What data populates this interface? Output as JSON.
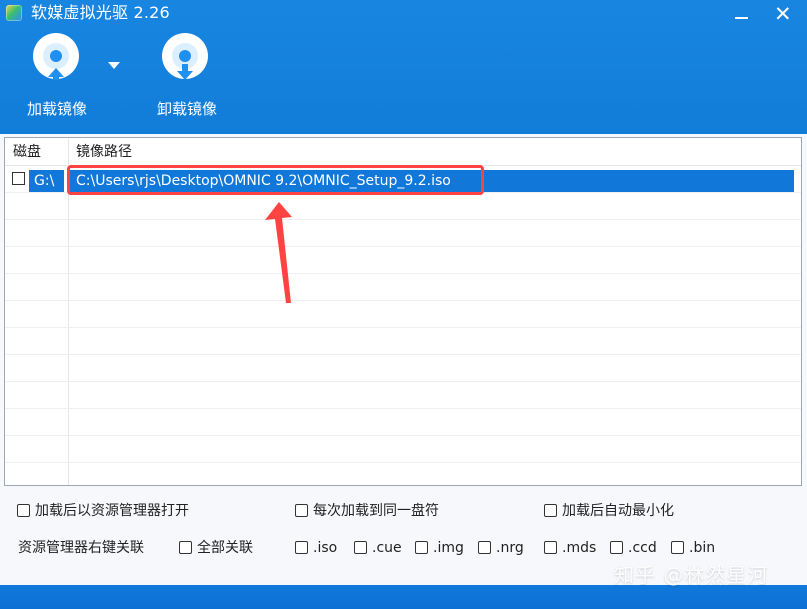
{
  "window": {
    "title": "软媒虚拟光驱 2.26",
    "minimize_glyph": "—",
    "close_glyph": "✕"
  },
  "toolbar": {
    "load_label": "加载镜像",
    "unload_label": "卸载镜像",
    "load_icon": "disc-up-icon",
    "unload_icon": "disc-down-icon",
    "dropdown_icon": "triangle-down-icon",
    "accent_color": "#1886e1"
  },
  "table": {
    "columns": {
      "disk": "磁盘",
      "path": "镜像路径"
    },
    "rows": [
      {
        "drive": "G:\\",
        "path": "C:\\Users\\rjs\\Desktop\\OMNIC 9.2\\OMNIC_Setup_9.2.iso",
        "checked": false
      }
    ],
    "selection_color": "#1177d8"
  },
  "options": {
    "open_explorer_after_mount": "加载后以资源管理器打开",
    "mount_same_drive_each_time": "每次加载到同一盘符",
    "auto_minimize_after_mount": "加载后自动最小化",
    "explorer_context_label": "资源管理器右键关联",
    "all_associate": "全部关联",
    "file_types": [
      ".iso",
      ".cue",
      ".img",
      ".nrg",
      ".mds",
      ".ccd",
      ".bin"
    ]
  },
  "annotation": {
    "color": "#ff4343"
  },
  "watermark": {
    "text": "知乎 @林然星河"
  }
}
